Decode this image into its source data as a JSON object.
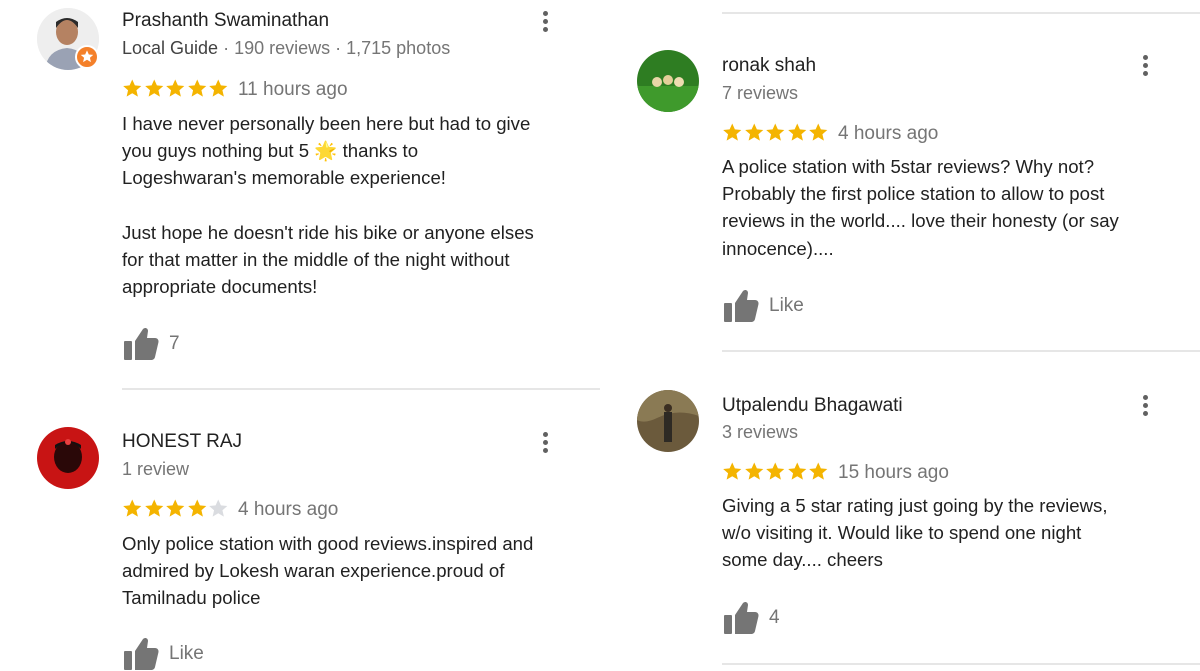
{
  "reviews": [
    {
      "name": "Prashanth Swaminathan",
      "guide_label": "Local Guide",
      "meta_rest": " · 190 reviews · 1,715 photos",
      "stars": 5,
      "time": "11 hours ago",
      "text": "I have never personally been here but had to give\nyou guys nothing but 5 🌟 thanks to\nLogeshwaran's memorable experience!\n\nJust hope he doesn't ride his bike or anyone elses\nfor that matter in the middle of the night without\nappropriate documents!",
      "likes": "7"
    },
    {
      "name": "HONEST RAJ",
      "meta": "1 review",
      "stars": 4,
      "time": "4 hours ago",
      "text": "Only police station with good reviews.inspired and\nadmired by Lokesh waran experience.proud of\nTamilnadu police",
      "likes": "Like"
    },
    {
      "name": "ronak shah",
      "meta": "7 reviews",
      "stars": 5,
      "time": "4 hours ago",
      "text": "A police station with 5star reviews? Why not?\nProbably the first police station to allow to post\nreviews in the world.... love their honesty (or say\ninnocence)....",
      "likes": "Like"
    },
    {
      "name": "Utpalendu Bhagawati",
      "meta": "3 reviews",
      "stars": 5,
      "time": "15 hours ago",
      "text": "Giving a 5 star rating just going by the reviews,\nw/o visiting it. Would like to spend one night\nsome day.... cheers",
      "likes": "4"
    }
  ],
  "colors": {
    "star_filled": "#f4b400",
    "star_empty": "#dadce0",
    "badge": "#f4802a",
    "divider": "#e6e6e6"
  },
  "icons": {
    "like": "thumbs-up-icon",
    "menu": "more-vert-icon",
    "badge": "local-guide-badge-icon"
  }
}
